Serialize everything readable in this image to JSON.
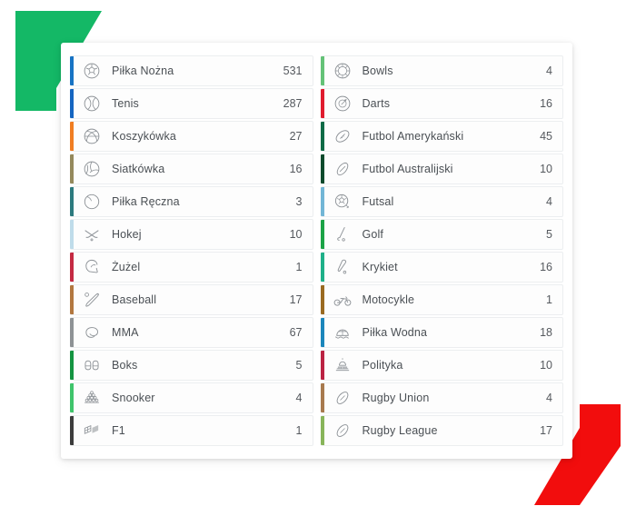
{
  "decoration": {
    "top_left_color": "#14b866",
    "bottom_right_color": "#f20d0d",
    "top_left_name": "green-arrow-decoration",
    "bottom_right_name": "red-arrow-decoration"
  },
  "panel": {
    "columns": [
      {
        "name": "left-column",
        "items": [
          {
            "label": "Piłka Nożna",
            "count": "531",
            "color": "#1773c4",
            "icon": "soccer-ball-icon"
          },
          {
            "label": "Tenis",
            "count": "287",
            "color": "#1565c0",
            "icon": "tennis-ball-icon"
          },
          {
            "label": "Koszykówka",
            "count": "27",
            "color": "#f07d22",
            "icon": "basketball-icon"
          },
          {
            "label": "Siatkówka",
            "count": "16",
            "color": "#94895c",
            "icon": "volleyball-icon"
          },
          {
            "label": "Piłka Ręczna",
            "count": "3",
            "color": "#2c7a7e",
            "icon": "handball-icon"
          },
          {
            "label": "Hokej",
            "count": "10",
            "color": "#bfdcea",
            "icon": "hockey-sticks-icon"
          },
          {
            "label": "Żużel",
            "count": "1",
            "color": "#c42a42",
            "icon": "speedway-helmet-icon"
          },
          {
            "label": "Baseball",
            "count": "17",
            "color": "#b2773f",
            "icon": "baseball-bat-icon"
          },
          {
            "label": "MMA",
            "count": "67",
            "color": "#8e9295",
            "icon": "mma-glove-icon"
          },
          {
            "label": "Boks",
            "count": "5",
            "color": "#149441",
            "icon": "boxing-gloves-icon"
          },
          {
            "label": "Snooker",
            "count": "4",
            "color": "#3fc46b",
            "icon": "snooker-balls-icon"
          },
          {
            "label": "F1",
            "count": "1",
            "color": "#3c3c3c",
            "icon": "racing-flag-icon"
          }
        ]
      },
      {
        "name": "right-column",
        "items": [
          {
            "label": "Bowls",
            "count": "4",
            "color": "#64c277",
            "icon": "bowls-ball-icon"
          },
          {
            "label": "Darts",
            "count": "16",
            "color": "#e01b2e",
            "icon": "dartboard-icon"
          },
          {
            "label": "Futbol Amerykański",
            "count": "45",
            "color": "#0f6b46",
            "icon": "american-football-icon"
          },
          {
            "label": "Futbol Australijski",
            "count": "10",
            "color": "#0c4a2c",
            "icon": "australian-football-icon"
          },
          {
            "label": "Futsal",
            "count": "4",
            "color": "#72b6d6",
            "icon": "futsal-ball-icon"
          },
          {
            "label": "Golf",
            "count": "5",
            "color": "#1ba346",
            "icon": "golf-club-icon"
          },
          {
            "label": "Krykiet",
            "count": "16",
            "color": "#1fb089",
            "icon": "cricket-bat-icon"
          },
          {
            "label": "Motocykle",
            "count": "1",
            "color": "#9a6a21",
            "icon": "motorcycle-icon"
          },
          {
            "label": "Piłka Wodna",
            "count": "18",
            "color": "#1b86bb",
            "icon": "water-polo-icon"
          },
          {
            "label": "Polityka",
            "count": "10",
            "color": "#bb2343",
            "icon": "capitol-building-icon"
          },
          {
            "label": "Rugby Union",
            "count": "4",
            "color": "#a87a4e",
            "icon": "rugby-ball-icon"
          },
          {
            "label": "Rugby League",
            "count": "17",
            "color": "#88b55a",
            "icon": "rugby-ball-icon"
          }
        ]
      }
    ]
  }
}
